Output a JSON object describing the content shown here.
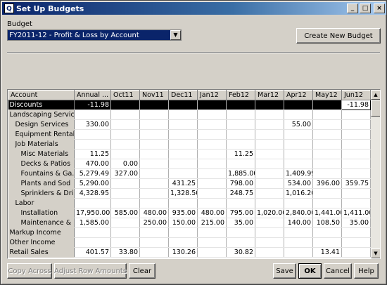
{
  "window": {
    "title": "Set Up Budgets",
    "minimize": "_",
    "maximize": "□",
    "close": "×"
  },
  "budget": {
    "label": "Budget",
    "selected": "FY2011-12 - Profit & Loss by Account",
    "create_button": "Create New Budget"
  },
  "grid": {
    "columns": [
      "Account",
      "Annual ...",
      "Oct11",
      "Nov11",
      "Dec11",
      "Jan12",
      "Feb12",
      "Mar12",
      "Apr12",
      "May12",
      "Jun12"
    ],
    "rows": [
      {
        "account": "Discounts",
        "values": [
          "-11.98",
          "",
          "",
          "",
          "",
          "",
          "",
          "",
          "",
          "-11.98"
        ],
        "selected": true
      },
      {
        "account": "Landscaping Services",
        "values": [
          "",
          "",
          "",
          "",
          "",
          "",
          "",
          "",
          "",
          ""
        ]
      },
      {
        "account": "Design Services",
        "values": [
          "330.00",
          "",
          "",
          "",
          "",
          "",
          "",
          "55.00",
          "",
          ""
        ]
      },
      {
        "account": "Equipment Rental",
        "values": [
          "",
          "",
          "",
          "",
          "",
          "",
          "",
          "",
          "",
          ""
        ]
      },
      {
        "account": "Job Materials",
        "values": [
          "",
          "",
          "",
          "",
          "",
          "",
          "",
          "",
          "",
          ""
        ]
      },
      {
        "account": "Misc Materials",
        "values": [
          "11.25",
          "",
          "",
          "",
          "",
          "11.25",
          "",
          "",
          "",
          ""
        ]
      },
      {
        "account": "Decks & Patios",
        "values": [
          "470.00",
          "0.00",
          "",
          "",
          "",
          "",
          "",
          "",
          "",
          ""
        ]
      },
      {
        "account": "Fountains & Ga...",
        "values": [
          "5,279.49",
          "327.00",
          "",
          "",
          "",
          "1,885.00",
          "",
          "1,409.99",
          "",
          ""
        ]
      },
      {
        "account": "Plants and Sod",
        "values": [
          "5,290.00",
          "",
          "",
          "431.25",
          "",
          "798.00",
          "",
          "534.00",
          "396.00",
          "359.75"
        ]
      },
      {
        "account": "Sprinklers & Dri...",
        "values": [
          "4,328.95",
          "",
          "",
          "1,328.50",
          "",
          "248.75",
          "",
          "1,016.20",
          "",
          ""
        ]
      },
      {
        "account": "Labor",
        "values": [
          "",
          "",
          "",
          "",
          "",
          "",
          "",
          "",
          "",
          ""
        ]
      },
      {
        "account": "Installation",
        "values": [
          "17,950.00",
          "585.00",
          "480.00",
          "935.00",
          "480.00",
          "795.00",
          "1,020.00",
          "2,840.00",
          "1,441.00",
          "1,411.00"
        ]
      },
      {
        "account": "Maintenance & ...",
        "values": [
          "1,585.00",
          "",
          "250.00",
          "150.00",
          "215.00",
          "35.00",
          "",
          "140.00",
          "108.50",
          "35.00"
        ]
      },
      {
        "account": "Markup Income",
        "values": [
          "",
          "",
          "",
          "",
          "",
          "",
          "",
          "",
          "",
          ""
        ]
      },
      {
        "account": "Other Income",
        "values": [
          "",
          "",
          "",
          "",
          "",
          "",
          "",
          "",
          "",
          ""
        ]
      },
      {
        "account": "Retail Sales",
        "values": [
          "401.57",
          "33.80",
          "",
          "130.26",
          "",
          "30.82",
          "",
          "",
          "13.41",
          ""
        ]
      }
    ],
    "indent": [
      0,
      0,
      1,
      1,
      1,
      2,
      2,
      2,
      2,
      2,
      1,
      2,
      2,
      0,
      0,
      0
    ]
  },
  "footer": {
    "copy_across": "Copy Across",
    "adjust_rows": "Adjust Row Amounts",
    "clear": "Clear",
    "save": "Save",
    "ok": "OK",
    "cancel": "Cancel",
    "help": "Help"
  }
}
